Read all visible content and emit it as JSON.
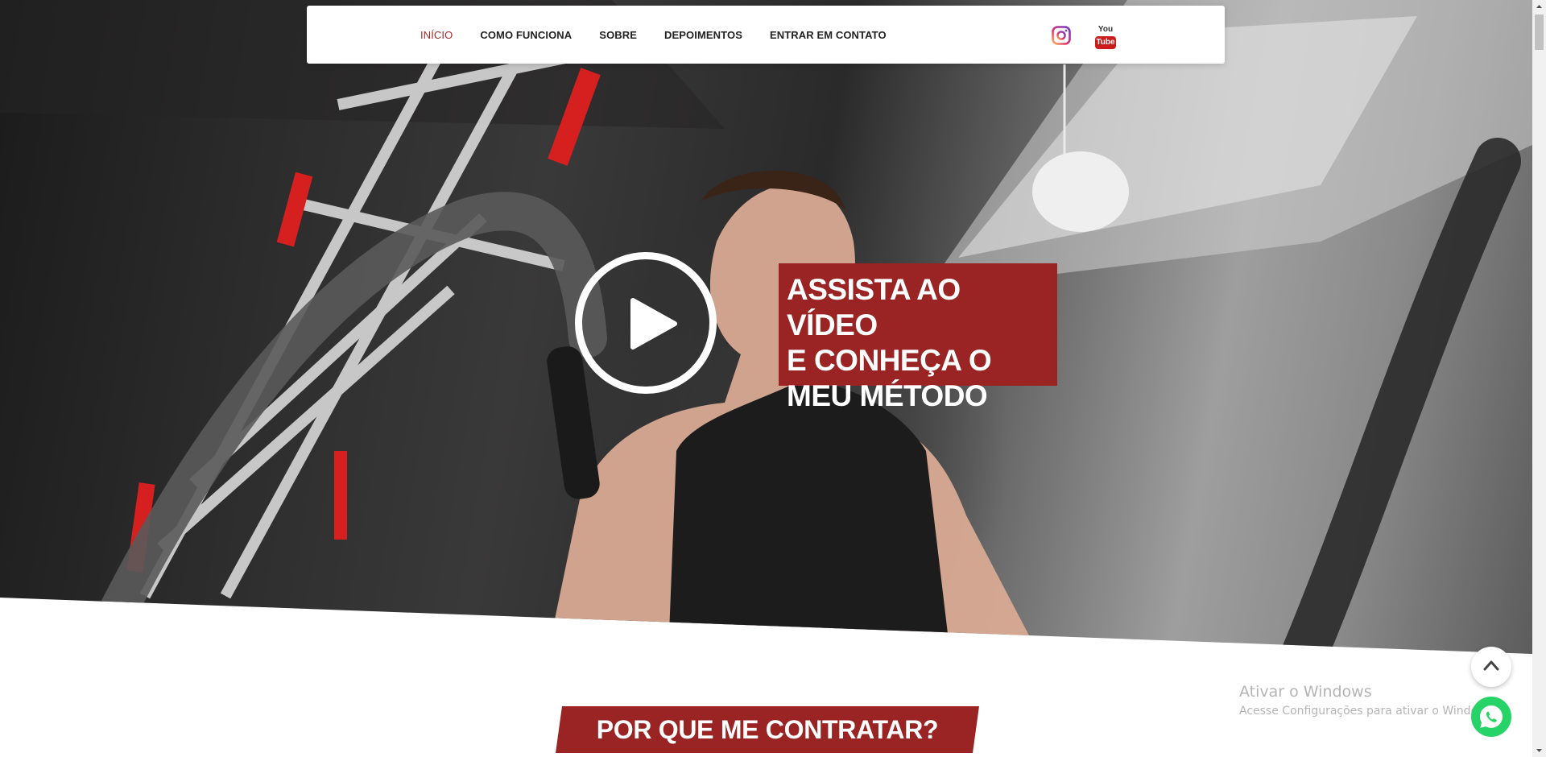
{
  "nav": {
    "items": [
      {
        "label": "INÍCIO",
        "active": true
      },
      {
        "label": "COMO FUNCIONA",
        "active": false
      },
      {
        "label": "SOBRE",
        "active": false
      },
      {
        "label": "DEPOIMENTOS",
        "active": false
      },
      {
        "label": "ENTRAR EM CONTATO",
        "active": false
      }
    ],
    "social": {
      "instagram_icon": "instagram-icon",
      "youtube_icon": "youtube-icon",
      "youtube_text_top": "You",
      "youtube_text_bottom": "Tube"
    }
  },
  "hero": {
    "cta_lines": [
      "ASSISTA AO VÍDEO",
      "E CONHEÇA O",
      "MEU MÉTODO"
    ],
    "play_icon": "play-icon"
  },
  "section": {
    "title": "POR QUE ME CONTRATAR?"
  },
  "windows_notice": {
    "title": "Ativar o Windows",
    "subtitle": "Acesse Configurações para ativar o Windows."
  },
  "floating": {
    "back_to_top_icon": "chevron-up-icon",
    "whatsapp_icon": "whatsapp-icon"
  },
  "colors": {
    "accent": "#9a2424",
    "active_link": "#a32b2b",
    "whatsapp": "#25d366",
    "nav_bg": "#ffffff"
  }
}
